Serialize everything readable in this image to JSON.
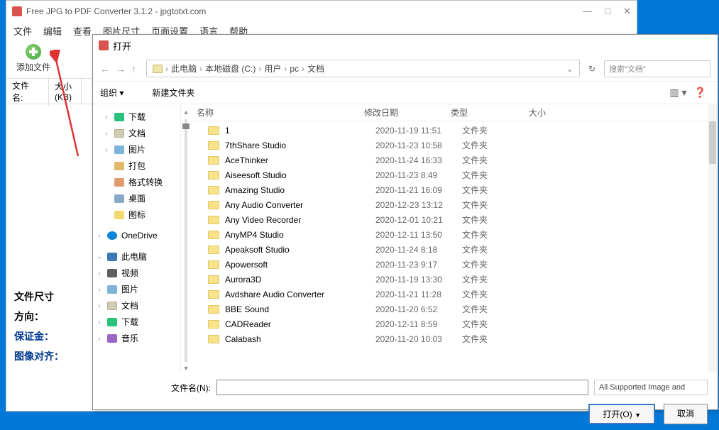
{
  "app": {
    "title": "Free JPG to PDF Converter 3.1.2 - jpgtotxt.com",
    "window_controls": {
      "min": "—",
      "max": "□",
      "close": "✕"
    }
  },
  "menu": [
    "文件",
    "编辑",
    "查看",
    "图片尺寸",
    "页面设置",
    "语言",
    "帮助"
  ],
  "toolbar": {
    "add_file_label": "添加文件"
  },
  "columns": {
    "filename": "文件\n名:",
    "size": "大小\n(KB)"
  },
  "sidebar_labels": [
    "文件尺寸",
    "方向：",
    "保证金：",
    "图像对齐："
  ],
  "dialog": {
    "title": "打开",
    "breadcrumb": [
      "此电脑",
      "本地磁盘 (C:)",
      "用户",
      "pc",
      "文档"
    ],
    "refresh_icon": "↻",
    "search_placeholder": "搜索\"文档\"",
    "toolbar": {
      "organize": "组织 ▾",
      "new_folder": "新建文件夹",
      "view_icon": "▥ ▾",
      "help_icon": "❓"
    },
    "tree": [
      {
        "icon": "ic-download",
        "label": "下载",
        "exp": "›"
      },
      {
        "icon": "ic-docs",
        "label": "文档",
        "exp": "›"
      },
      {
        "icon": "ic-pic",
        "label": "图片",
        "exp": "›"
      },
      {
        "icon": "ic-pack",
        "label": "打包",
        "exp": ""
      },
      {
        "icon": "ic-convert",
        "label": "格式转换",
        "exp": ""
      },
      {
        "icon": "ic-desktop",
        "label": "桌面",
        "exp": ""
      },
      {
        "icon": "ic-icons",
        "label": "图标",
        "exp": ""
      }
    ],
    "tree2": [
      {
        "icon": "ic-onedrive",
        "label": "OneDrive",
        "exp": "›"
      }
    ],
    "tree3": [
      {
        "icon": "ic-pc",
        "label": "此电脑",
        "exp": "⌄"
      },
      {
        "icon": "ic-video",
        "label": "视频",
        "exp": "›"
      },
      {
        "icon": "ic-pic",
        "label": "图片",
        "exp": "›"
      },
      {
        "icon": "ic-docs",
        "label": "文档",
        "exp": "›"
      },
      {
        "icon": "ic-download",
        "label": "下载",
        "exp": "›"
      },
      {
        "icon": "ic-music",
        "label": "音乐",
        "exp": "›"
      }
    ],
    "list_header": {
      "name": "名称",
      "date": "修改日期",
      "type": "类型",
      "size": "大小"
    },
    "rows": [
      {
        "name": "1",
        "date": "2020-11-19 11:51",
        "type": "文件夹"
      },
      {
        "name": "7thShare Studio",
        "date": "2020-11-23 10:58",
        "type": "文件夹"
      },
      {
        "name": "AceThinker",
        "date": "2020-11-24 16:33",
        "type": "文件夹"
      },
      {
        "name": "Aiseesoft Studio",
        "date": "2020-11-23 8:49",
        "type": "文件夹"
      },
      {
        "name": "Amazing Studio",
        "date": "2020-11-21 16:09",
        "type": "文件夹"
      },
      {
        "name": "Any Audio Converter",
        "date": "2020-12-23 13:12",
        "type": "文件夹"
      },
      {
        "name": "Any Video Recorder",
        "date": "2020-12-01 10:21",
        "type": "文件夹"
      },
      {
        "name": "AnyMP4 Studio",
        "date": "2020-12-11 13:50",
        "type": "文件夹"
      },
      {
        "name": "Apeaksoft Studio",
        "date": "2020-11-24 8:18",
        "type": "文件夹"
      },
      {
        "name": "Apowersoft",
        "date": "2020-11-23 9:17",
        "type": "文件夹"
      },
      {
        "name": "Aurora3D",
        "date": "2020-11-19 13:30",
        "type": "文件夹"
      },
      {
        "name": "Avdshare Audio Converter",
        "date": "2020-11-21 11:28",
        "type": "文件夹"
      },
      {
        "name": "BBE Sound",
        "date": "2020-11-20 6:52",
        "type": "文件夹"
      },
      {
        "name": "CADReader",
        "date": "2020-12-11 8:59",
        "type": "文件夹"
      },
      {
        "name": "Calabash",
        "date": "2020-11-20 10:03",
        "type": "文件夹"
      }
    ],
    "footer": {
      "filename_label": "文件名(N):",
      "filename_value": "",
      "filter": "All Supported Image and",
      "open": "打开(O)",
      "cancel": "取消"
    }
  }
}
